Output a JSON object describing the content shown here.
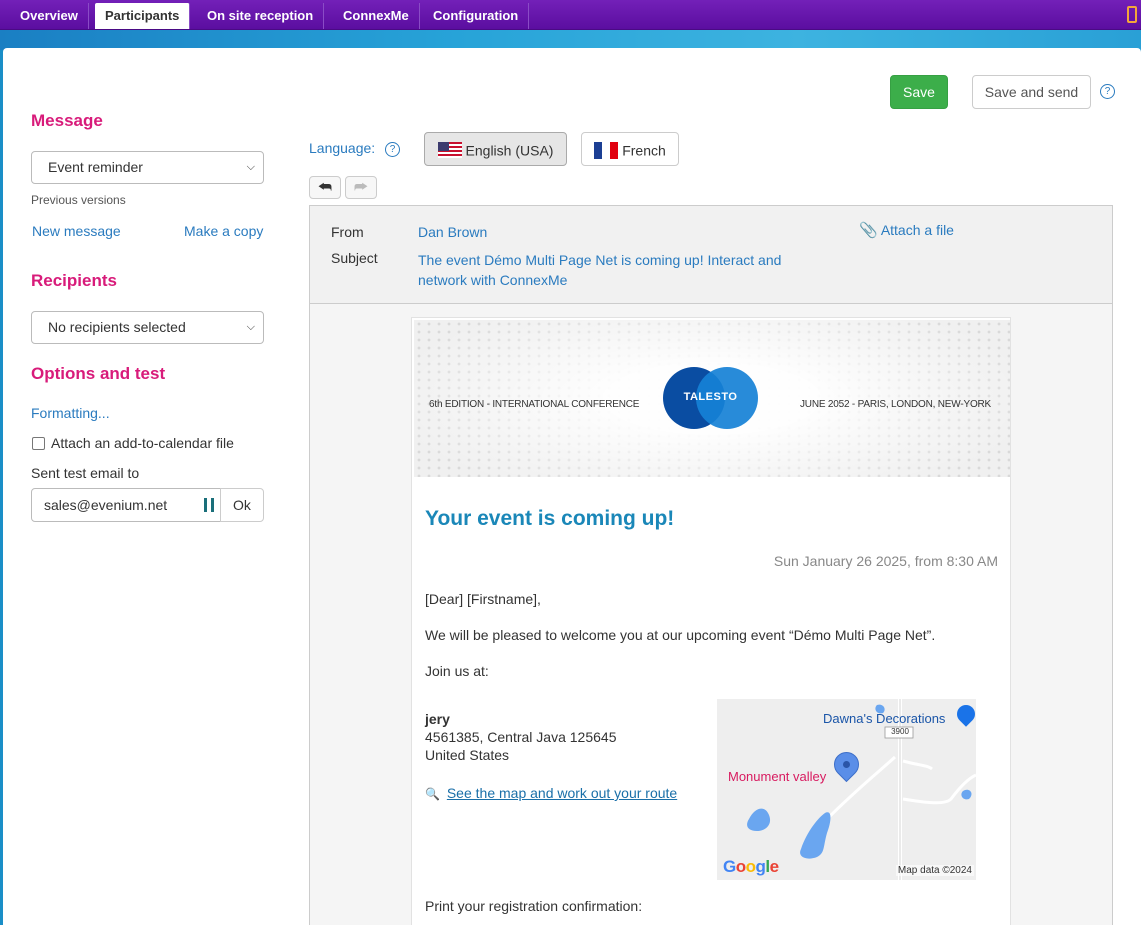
{
  "nav": {
    "tabs": [
      {
        "label": "Overview"
      },
      {
        "label": "Participants"
      },
      {
        "label": "On site reception"
      },
      {
        "label": "ConnexMe"
      },
      {
        "label": "Configuration"
      }
    ]
  },
  "toolbar": {
    "save_label": "Save",
    "save_send_label": "Save and send",
    "help": "?"
  },
  "left": {
    "message_title": "Message",
    "message_select": "Event reminder",
    "previous_versions": "Previous versions",
    "new_message": "New message",
    "make_copy": "Make a copy",
    "recipients_title": "Recipients",
    "recipients_select": "No recipients selected",
    "options_title": "Options and test",
    "formatting": "Formatting...",
    "calendar_label": "Attach an add-to-calendar file",
    "test_email_label": "Sent test email to",
    "test_email_value": "sales@evenium.net",
    "ok_label": "Ok"
  },
  "language": {
    "label": "Language:",
    "english": "English (USA)",
    "french": "French"
  },
  "header": {
    "from_label": "From",
    "from_value": "Dan Brown",
    "subject_label": "Subject",
    "subject_line1": "The event Démo Multi Page Net is coming up! Interact and",
    "subject_line2": "network with ConnexMe",
    "attach": "Attach a file"
  },
  "email": {
    "hero_left": "6th EDITION - INTERNATIONAL CONFERENCE",
    "hero_logo": "TALESTO",
    "hero_right": "JUNE 2052 - PARIS, LONDON, NEW-YORK",
    "title": "Your event is coming up!",
    "date": "Sun January 26 2025, from 8:30 AM",
    "greeting": "[Dear] [Firstname],",
    "welcome": "We will be pleased to welcome you at our upcoming event “Démo Multi Page Net”.",
    "join": "Join us at:",
    "venue_name": "jery",
    "venue_address": "4561385, Central Java 125645",
    "venue_country": "United States",
    "map_link": "See the map and work out your route",
    "print": "Print your registration confirmation:"
  },
  "map": {
    "place1": "Dawna's Decorations",
    "place2": "Monument valley",
    "road": "3900",
    "brand": "Google",
    "credit": "Map data ©2024"
  },
  "colors": {
    "nav_bg": "#6a0dad",
    "accent_pink": "#d81b7a",
    "link_blue": "#2a7bbf",
    "save_green": "#3cae4a",
    "title_blue": "#1a87b8"
  }
}
